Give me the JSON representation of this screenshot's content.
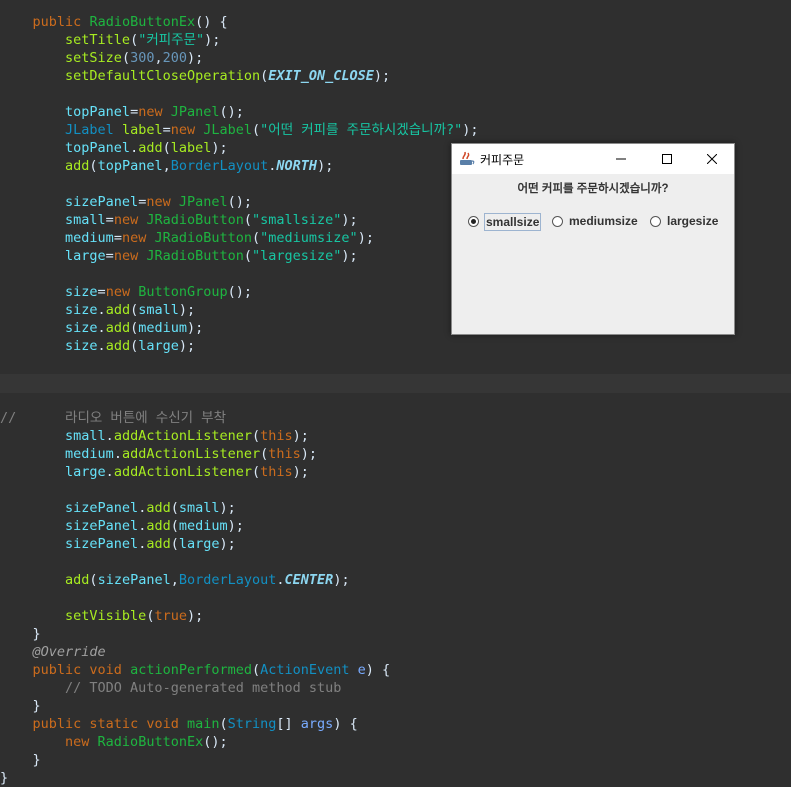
{
  "code": {
    "l01": {
      "a": "public",
      "b": "RadioButtonEx",
      "c": "() {"
    },
    "l02": {
      "a": "setTitle",
      "b": "(",
      "c": "\"커피주문\"",
      "d": ");"
    },
    "l03": {
      "a": "setSize",
      "b": "(",
      "c": "300",
      "d": ",",
      "e": "200",
      "f": ");"
    },
    "l04": {
      "a": "setDefaultCloseOperation",
      "b": "(",
      "c": "EXIT_ON_CLOSE",
      "d": ");"
    },
    "l05": {
      "a": "topPanel",
      "b": "=",
      "c": "new",
      "d": " JPanel",
      "e": "();"
    },
    "l06": {
      "a": "JLabel",
      "b": " label",
      "c": "=",
      "d": "new",
      "e": " JLabel",
      "f": "(",
      "g": "\"어떤 커피를 주문하시겠습니까?\"",
      "h": ");"
    },
    "l07": {
      "a": "topPanel",
      "b": ".",
      "c": "add",
      "d": "(",
      "e": "label",
      "f": ");"
    },
    "l08": {
      "a": "add",
      "b": "(",
      "c": "topPanel",
      "d": ",",
      "e": "BorderLayout",
      "f": ".",
      "g": "NORTH",
      "h": ");"
    },
    "l09": {
      "a": "sizePanel",
      "b": "=",
      "c": "new",
      "d": " JPanel",
      "e": "();"
    },
    "l10": {
      "a": "small",
      "b": "=",
      "c": "new",
      "d": " JRadioButton",
      "e": "(",
      "f": "\"smallsize\"",
      "g": ");"
    },
    "l11": {
      "a": "medium",
      "b": "=",
      "c": "new",
      "d": " JRadioButton",
      "e": "(",
      "f": "\"mediumsize\"",
      "g": ");"
    },
    "l12": {
      "a": "large",
      "b": "=",
      "c": "new",
      "d": " JRadioButton",
      "e": "(",
      "f": "\"largesize\"",
      "g": ");"
    },
    "l13": {
      "a": "size",
      "b": "=",
      "c": "new",
      "d": " ButtonGroup",
      "e": "();"
    },
    "l14": {
      "a": "size",
      "b": ".",
      "c": "add",
      "d": "(",
      "e": "small",
      "f": ");"
    },
    "l15": {
      "a": "size",
      "b": ".",
      "c": "add",
      "d": "(",
      "e": "medium",
      "f": ");"
    },
    "l16": {
      "a": "size",
      "b": ".",
      "c": "add",
      "d": "(",
      "e": "large",
      "f": ");"
    },
    "l17": {
      "a": "//      라디오 버튼에 수신기 부착"
    },
    "l18": {
      "a": "small",
      "b": ".",
      "c": "addActionListener",
      "d": "(",
      "e": "this",
      "f": ");"
    },
    "l19": {
      "a": "medium",
      "b": ".",
      "c": "addActionListener",
      "d": "(",
      "e": "this",
      "f": ");"
    },
    "l20": {
      "a": "large",
      "b": ".",
      "c": "addActionListener",
      "d": "(",
      "e": "this",
      "f": ");"
    },
    "l21": {
      "a": "sizePanel",
      "b": ".",
      "c": "add",
      "d": "(",
      "e": "small",
      "f": ");"
    },
    "l22": {
      "a": "sizePanel",
      "b": ".",
      "c": "add",
      "d": "(",
      "e": "medium",
      "f": ");"
    },
    "l23": {
      "a": "sizePanel",
      "b": ".",
      "c": "add",
      "d": "(",
      "e": "large",
      "f": ");"
    },
    "l24": {
      "a": "add",
      "b": "(",
      "c": "sizePanel",
      "d": ",",
      "e": "BorderLayout",
      "f": ".",
      "g": "CENTER",
      "h": ");"
    },
    "l25": {
      "a": "setVisible",
      "b": "(",
      "c": "true",
      "d": ");"
    },
    "l26": {
      "a": "}"
    },
    "l27": {
      "a": "@Override"
    },
    "l28": {
      "a": "public",
      "b": " void",
      "c": " actionPerformed",
      "d": "(",
      "e": "ActionEvent",
      "f": " e",
      "g": ") {"
    },
    "l29": {
      "a": "// TODO Auto-generated method stub"
    },
    "l30": {
      "a": "}"
    },
    "l31": {
      "a": "public",
      "b": " static",
      "c": " void",
      "d": " main",
      "e": "(",
      "f": "String",
      "g": "[] ",
      "h": "args",
      "i": ") {"
    },
    "l32": {
      "a": "new",
      "b": " RadioButtonEx",
      "c": "();"
    },
    "l33": {
      "a": "}"
    },
    "l34": {
      "a": "}"
    }
  },
  "window": {
    "title": "커피주문",
    "prompt_label": "어떤 커피를 주문하시겠습니까?",
    "radios": [
      {
        "label": "smallsize",
        "selected": true
      },
      {
        "label": "mediumsize",
        "selected": false
      },
      {
        "label": "largesize",
        "selected": false
      }
    ],
    "icons": {
      "minimize": "minimize-icon",
      "maximize": "maximize-icon",
      "close": "close-icon",
      "app": "java-icon"
    }
  }
}
